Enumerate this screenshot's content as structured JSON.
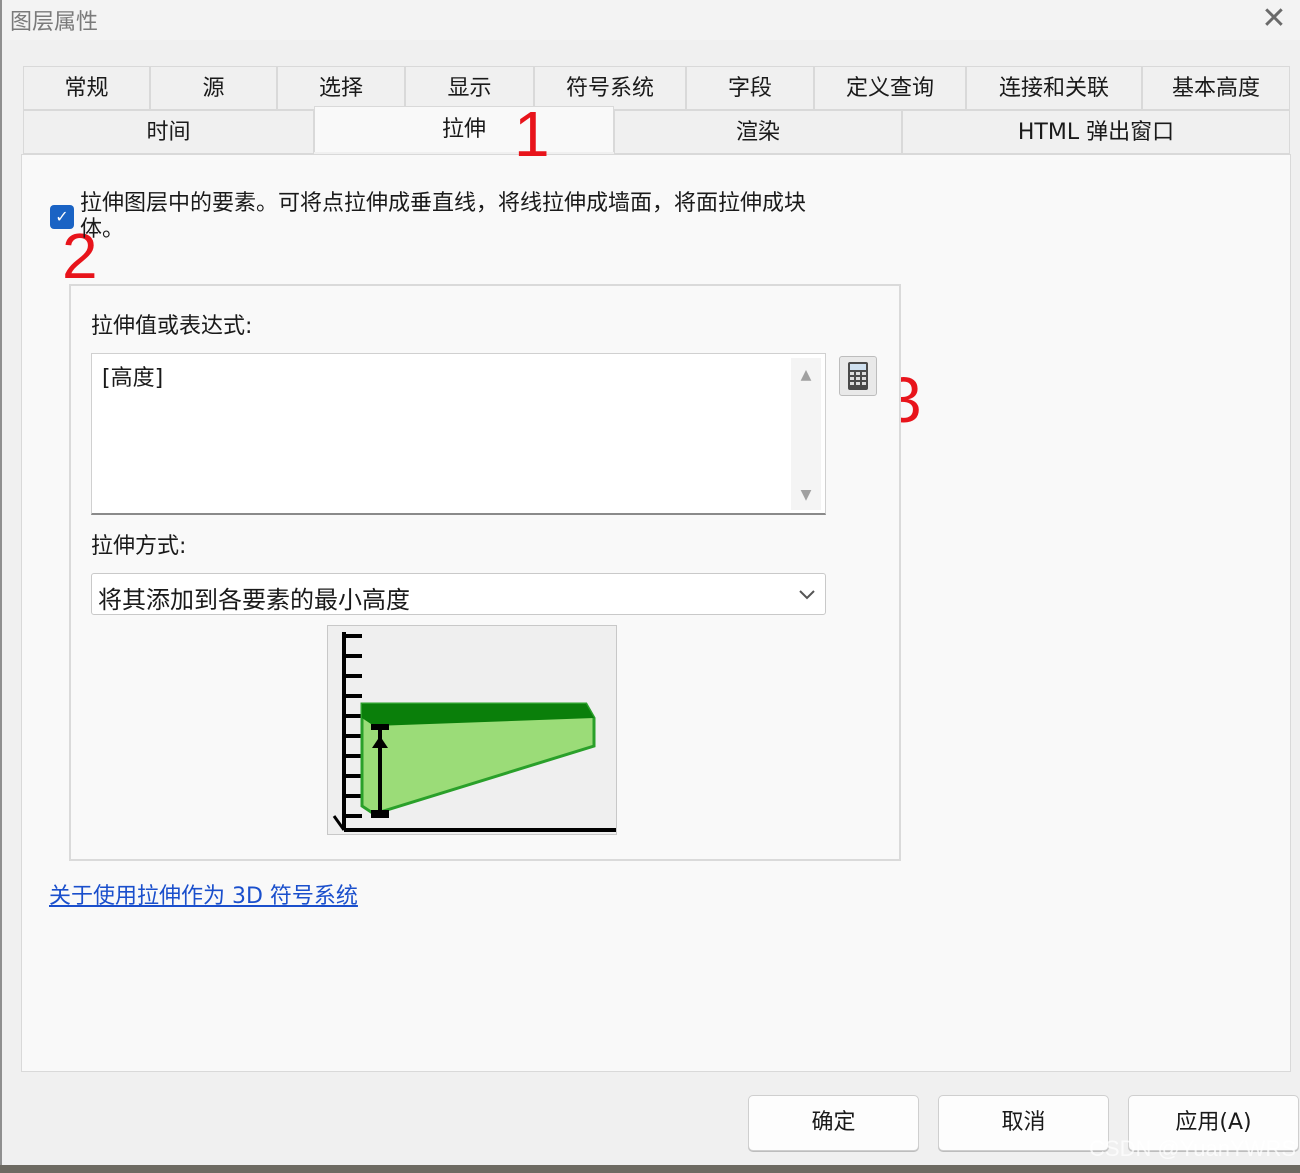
{
  "window": {
    "title": "图层属性"
  },
  "tabs_row1": [
    "常规",
    "源",
    "选择",
    "显示",
    "符号系统",
    "字段",
    "定义查询",
    "连接和关联",
    "基本高度"
  ],
  "tabs_row2": [
    "时间",
    "拉伸",
    "渲染",
    "HTML 弹出窗口"
  ],
  "active_tab": "拉伸",
  "annotations": [
    "1",
    "2",
    "3"
  ],
  "extrude": {
    "checkbox_checked": true,
    "checkbox_label": "拉伸图层中的要素。可将点拉伸成垂直线，将线拉伸成墙面，将面拉伸成块体。",
    "expr_label": "拉伸值或表达式:",
    "expr_value": "[高度]",
    "calc_icon": "calculator-icon",
    "method_label": "拉伸方式:",
    "method_value": "将其添加到各要素的最小高度",
    "help_link": "关于使用拉伸作为 3D 符号系统"
  },
  "buttons": {
    "ok": "确定",
    "cancel": "取消",
    "apply": "应用(A)"
  },
  "watermark": "CSDN @YuanYWRS",
  "colors": {
    "accent": "#1a63c4",
    "annotation": "#e8141b",
    "link": "#1a4fcc",
    "extrude_dark": "#0a7f0a",
    "extrude_light": "#9bdc78"
  }
}
